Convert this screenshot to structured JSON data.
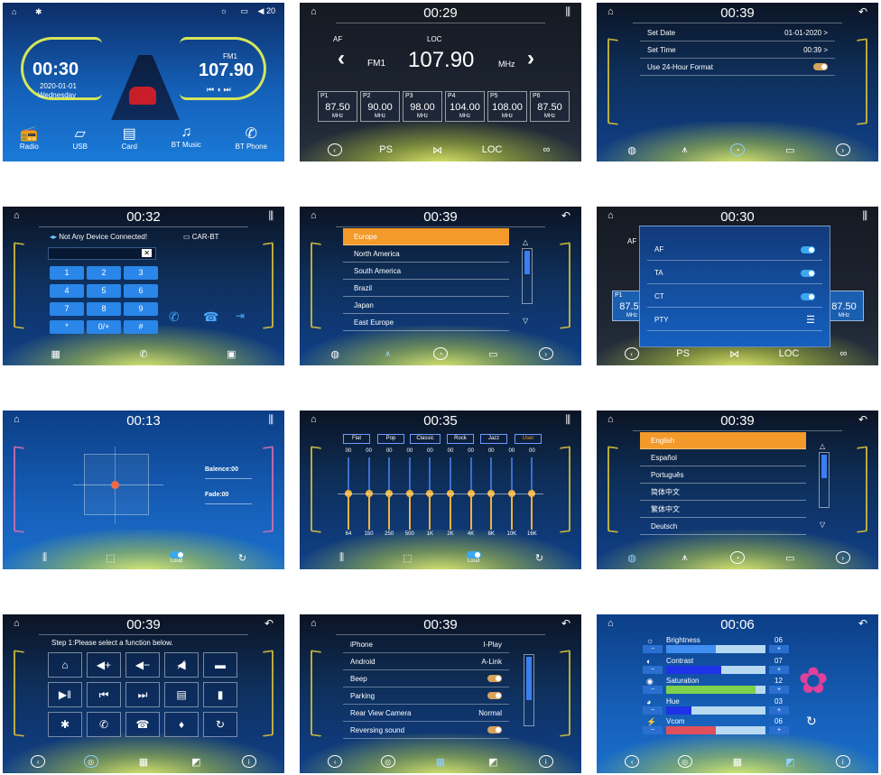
{
  "home": {
    "status": {
      "bluetooth_icon": "bluetooth-icon",
      "brightness_icon": "sun-icon",
      "battery_icon": "battery-icon",
      "volume": "20"
    },
    "time": "00:30",
    "date": "2020-01-01",
    "day": "Wednesday",
    "band": "FM1",
    "frequency": "107.90",
    "apps": [
      "Radio",
      "USB",
      "Card",
      "BT Music",
      "BT Phone"
    ]
  },
  "radio": {
    "time": "00:29",
    "af": "AF",
    "loc_top": "LOC",
    "band": "FM1",
    "frequency": "107.90",
    "unit": "MHz",
    "presets": [
      {
        "label": "P1",
        "value": "87.50",
        "unit": "MHz"
      },
      {
        "label": "P2",
        "value": "90.00",
        "unit": "MHz"
      },
      {
        "label": "P3",
        "value": "98.00",
        "unit": "MHz"
      },
      {
        "label": "P4",
        "value": "104.00",
        "unit": "MHz"
      },
      {
        "label": "P5",
        "value": "108.00",
        "unit": "MHz"
      },
      {
        "label": "P6",
        "value": "87.50",
        "unit": "MHz"
      }
    ],
    "bottom": {
      "ps": "PS",
      "loc": "LOC"
    }
  },
  "datetime": {
    "time": "00:39",
    "rows": [
      {
        "label": "Set Date",
        "value": "01-01-2020 >"
      },
      {
        "label": "Set Time",
        "value": "00:39 >"
      },
      {
        "label": "Use 24-Hour Format",
        "value": ""
      }
    ]
  },
  "phone": {
    "time": "00:32",
    "status": "Not Any Device Connected!",
    "device": "CAR-BT",
    "keys": [
      "1",
      "2",
      "3",
      "4",
      "5",
      "6",
      "7",
      "8",
      "9",
      "*",
      "0/+",
      "#"
    ]
  },
  "region": {
    "time": "00:39",
    "items": [
      "Europe",
      "North America",
      "South America",
      "Brazil",
      "Japan",
      "East Europe"
    ]
  },
  "rds": {
    "time": "00:30",
    "af": "AF",
    "options": [
      {
        "label": "AF"
      },
      {
        "label": "TA"
      },
      {
        "label": "CT"
      },
      {
        "label": "PTY"
      }
    ],
    "left_preset": {
      "label": "P1",
      "value": "87.50",
      "unit": "MHz"
    },
    "right_preset": {
      "value": "87.50",
      "unit": "MHz"
    },
    "bottom": {
      "ps": "PS",
      "loc": "LOC"
    }
  },
  "balance": {
    "time": "00:13",
    "balance_label": "Balence:00",
    "fade_label": "Fade:00",
    "loud": "Loud"
  },
  "eq": {
    "time": "00:35",
    "presets": [
      "Flat",
      "Pop",
      "Classic",
      "Rock",
      "Jazz",
      "User"
    ],
    "bands": [
      "64",
      "150",
      "250",
      "500",
      "1K",
      "2K",
      "4K",
      "8K",
      "10K",
      "16K"
    ],
    "values": [
      "00",
      "00",
      "00",
      "00",
      "00",
      "00",
      "00",
      "00",
      "00",
      "00"
    ],
    "loud": "Loud"
  },
  "language": {
    "time": "00:39",
    "items": [
      "English",
      "Español",
      "Português",
      "简体中文",
      "繁体中文",
      "Deutsch"
    ]
  },
  "steering": {
    "time": "00:39",
    "instruction": "Step 1:Please select a function below."
  },
  "settings": {
    "time": "00:39",
    "rows": [
      {
        "label": "iPhone",
        "value": "I-Play"
      },
      {
        "label": "Android",
        "value": "A-Link"
      },
      {
        "label": "Beep",
        "value": ""
      },
      {
        "label": "Parking",
        "value": ""
      },
      {
        "label": "Rear View Camera",
        "value": "Normal"
      },
      {
        "label": "Reversing sound",
        "value": ""
      }
    ]
  },
  "picture": {
    "time": "00:06",
    "rows": [
      {
        "label": "Brightness",
        "value": "06",
        "level": 0.5,
        "color": "#3f8ef0"
      },
      {
        "label": "Contrast",
        "value": "07",
        "level": 0.55,
        "color": "#1f32e8"
      },
      {
        "label": "Saturation",
        "value": "12",
        "level": 0.9,
        "color": "#7ed24b"
      },
      {
        "label": "Hue",
        "value": "03",
        "level": 0.25,
        "color": "#1f32e8"
      },
      {
        "label": "Vcom",
        "value": "06",
        "level": 0.5,
        "color": "#e0505a"
      }
    ]
  }
}
